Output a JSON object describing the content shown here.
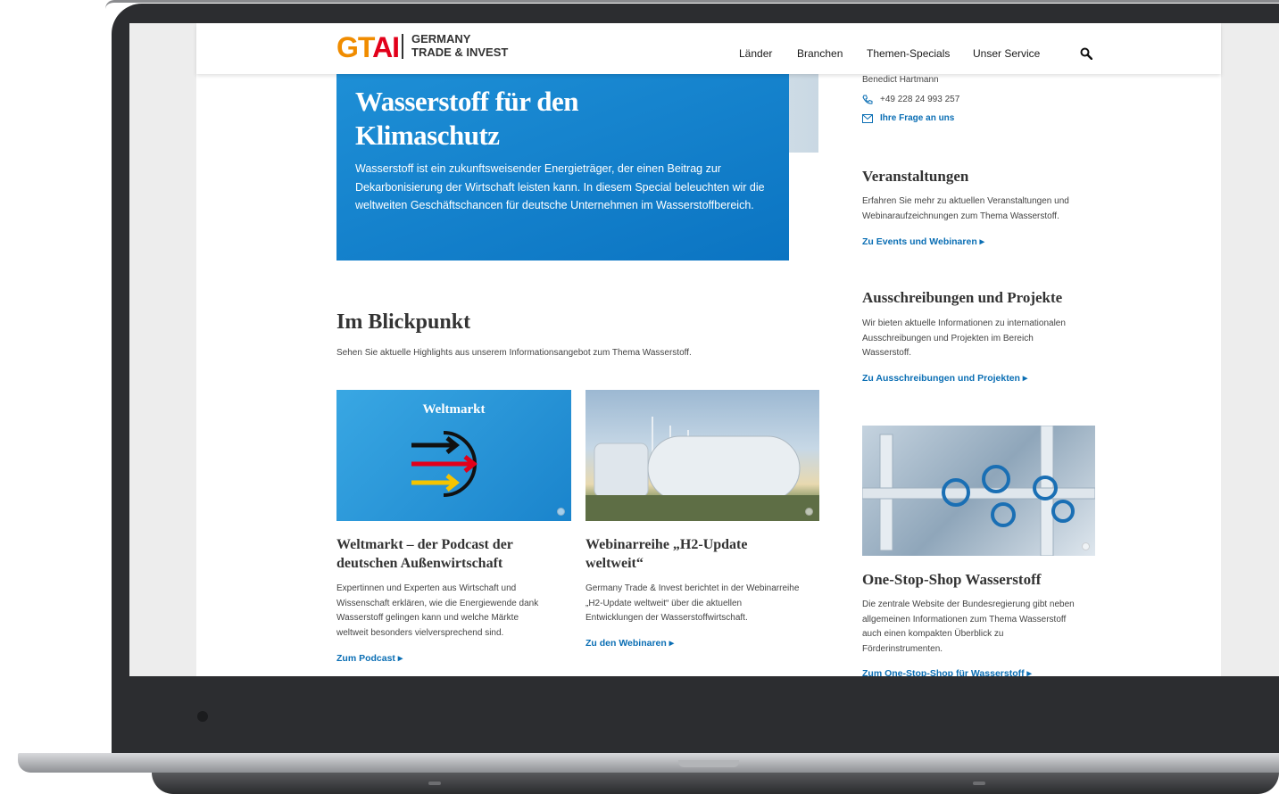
{
  "brand": {
    "logo": "GTAI",
    "name_line1": "GERMANY",
    "name_line2": "TRADE & INVEST",
    "colors": {
      "orange": "#f08c00",
      "red": "#e2001a",
      "blue": "#0a6eb4",
      "hero_blue": "#1e8fd6"
    }
  },
  "nav": {
    "items": [
      "Länder",
      "Branchen",
      "Themen-Specials",
      "Unser Service"
    ],
    "search_icon": "search-icon"
  },
  "hero": {
    "title_line1": "Wasserstoff für den",
    "title_line2": "Klimaschutz",
    "text": "Wasserstoff ist ein zukunftsweisender Energieträger, der einen Beitrag zur Dekarbonisierung der Wirtschaft leisten kann. In diesem Special beleuchten wir die weltweiten Geschäftschancen für deutsche Unternehmen im Wasserstoffbereich."
  },
  "blickpunkt": {
    "title": "Im Blickpunkt",
    "subtitle": "Sehen Sie aktuelle Highlights aus unserem Informationsangebot zum Thema Wasserstoff.",
    "cards": [
      {
        "image_label": "Weltmarkt",
        "title_line1": "Weltmarkt – der Podcast der",
        "title_line2": "deutschen Außenwirtschaft",
        "text": [
          "Expertinnen und Experten aus Wirtschaft und",
          "Wissenschaft erklären, wie die Energiewende dank",
          "Wasserstoff gelingen kann und welche Märkte",
          "weltweit besonders vielversprechend sind."
        ],
        "link": "Zum Podcast"
      },
      {
        "image_label": "",
        "title_line1": "Webinarreihe „H2-Update",
        "title_line2": "weltweit“",
        "text": [
          "Germany Trade & Invest berichtet in der Webinarreihe",
          "„H2-Update weltweit“ über die aktuellen",
          "Entwicklungen der Wasserstoffwirtschaft."
        ],
        "link": "Zu den Webinaren"
      }
    ]
  },
  "sidebar": {
    "contact_name": "Benedict Hartmann",
    "contact_phone": "+49 228 24 993 257",
    "contact_link": "Ihre Frage an uns",
    "events": {
      "title": "Veranstaltungen",
      "text": [
        "Erfahren Sie mehr zu aktuellen Veranstaltungen und",
        "Webinaraufzeichnungen zum Thema Wasserstoff."
      ],
      "link": "Zu Events und Webinaren"
    },
    "tenders": {
      "title": "Ausschreibungen und Projekte",
      "text": [
        "Wir bieten aktuelle Informationen zu internationalen",
        "Ausschreibungen und Projekten im Bereich",
        "Wasserstoff."
      ],
      "link": "Zu Ausschreibungen und Projekten"
    },
    "onestop": {
      "title": "One-Stop-Shop Wasserstoff",
      "text": [
        "Die zentrale Website der Bundesregierung gibt neben",
        "allgemeinen Informationen zum Thema Wasserstoff",
        "auch einen kompakten Überblick zu",
        "Förderinstrumenten."
      ],
      "link": "Zum One-Stop-Shop für Wasserstoff"
    }
  }
}
